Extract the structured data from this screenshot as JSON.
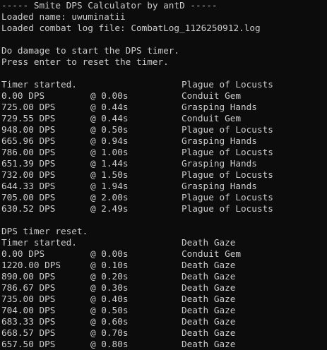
{
  "header": {
    "title": "----- Smite DPS Calculator by antD -----",
    "loaded_name": "Loaded name: uwuminatii",
    "loaded_log": "Loaded combat log file: CombatLog_1126250912.log",
    "instruction_start": "Do damage to start the DPS timer.",
    "instruction_reset": "Press enter to reset the timer."
  },
  "session1": {
    "status": "Timer started.",
    "status_ability": "Plague of Locusts",
    "rows": [
      {
        "dps": "0.00 DPS",
        "time": "@ 0.00s",
        "ability": "Conduit Gem"
      },
      {
        "dps": "725.00 DPS",
        "time": "@ 0.44s",
        "ability": "Grasping Hands"
      },
      {
        "dps": "729.55 DPS",
        "time": "@ 0.44s",
        "ability": "Conduit Gem"
      },
      {
        "dps": "948.00 DPS",
        "time": "@ 0.50s",
        "ability": "Plague of Locusts"
      },
      {
        "dps": "665.96 DPS",
        "time": "@ 0.94s",
        "ability": "Grasping Hands"
      },
      {
        "dps": "786.00 DPS",
        "time": "@ 1.00s",
        "ability": "Plague of Locusts"
      },
      {
        "dps": "651.39 DPS",
        "time": "@ 1.44s",
        "ability": "Grasping Hands"
      },
      {
        "dps": "732.00 DPS",
        "time": "@ 1.50s",
        "ability": "Plague of Locusts"
      },
      {
        "dps": "644.33 DPS",
        "time": "@ 1.94s",
        "ability": "Grasping Hands"
      },
      {
        "dps": "705.00 DPS",
        "time": "@ 2.00s",
        "ability": "Plague of Locusts"
      },
      {
        "dps": "630.52 DPS",
        "time": "@ 2.49s",
        "ability": "Plague of Locusts"
      }
    ]
  },
  "session2": {
    "reset_message": "DPS timer reset.",
    "status": "Timer started.",
    "status_ability": "Death Gaze",
    "rows": [
      {
        "dps": "0.00 DPS",
        "time": "@ 0.00s",
        "ability": "Conduit Gem"
      },
      {
        "dps": "1220.00 DPS",
        "time": "@ 0.10s",
        "ability": "Death Gaze"
      },
      {
        "dps": "890.00 DPS",
        "time": "@ 0.20s",
        "ability": "Death Gaze"
      },
      {
        "dps": "786.67 DPS",
        "time": "@ 0.30s",
        "ability": "Death Gaze"
      },
      {
        "dps": "735.00 DPS",
        "time": "@ 0.40s",
        "ability": "Death Gaze"
      },
      {
        "dps": "704.00 DPS",
        "time": "@ 0.50s",
        "ability": "Death Gaze"
      },
      {
        "dps": "683.33 DPS",
        "time": "@ 0.60s",
        "ability": "Death Gaze"
      },
      {
        "dps": "668.57 DPS",
        "time": "@ 0.70s",
        "ability": "Death Gaze"
      },
      {
        "dps": "657.50 DPS",
        "time": "@ 0.80s",
        "ability": "Death Gaze"
      }
    ]
  },
  "colors": {
    "background": "#0c0c0c",
    "text": "#cccccc"
  }
}
